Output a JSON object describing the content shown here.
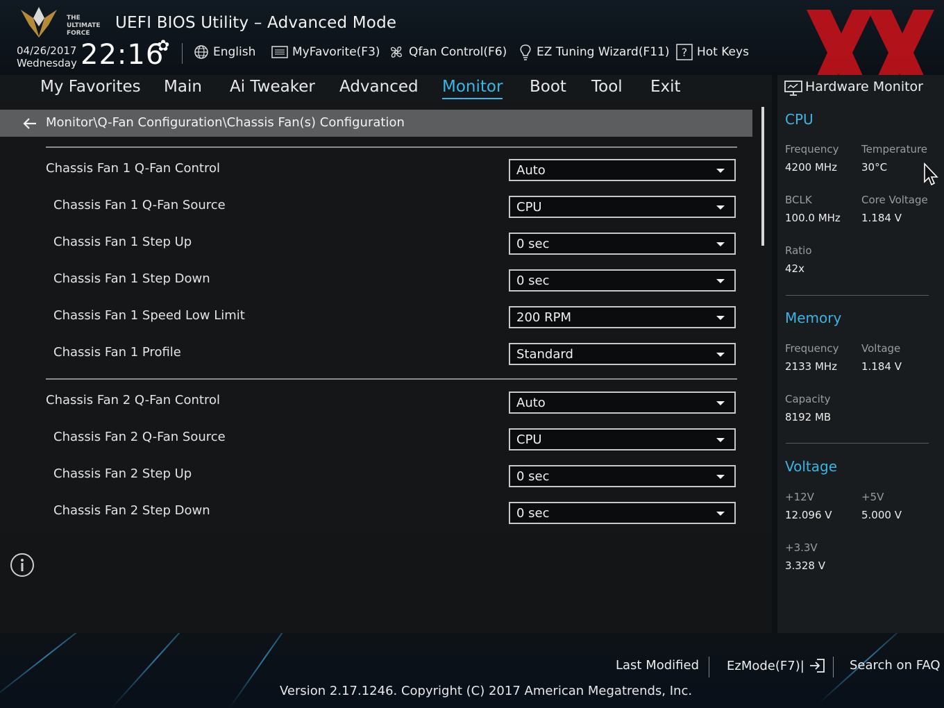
{
  "header": {
    "title": "UEFI BIOS Utility – Advanced Mode",
    "date": "04/26/2017",
    "weekday": "Wednesday",
    "time": "22:16",
    "logo_text": "THE ULTIMATE FORCE",
    "toolbar": [
      {
        "label": "English",
        "icon": "globe-icon"
      },
      {
        "label": "MyFavorite(F3)",
        "icon": "favorite-list-icon"
      },
      {
        "label": "Qfan Control(F6)",
        "icon": "fan-icon"
      },
      {
        "label": "EZ Tuning Wizard(F11)",
        "icon": "lightbulb-icon"
      },
      {
        "label": "Hot Keys",
        "icon": "question-box-icon"
      }
    ]
  },
  "nav": {
    "tabs": [
      "My Favorites",
      "Main",
      "Ai Tweaker",
      "Advanced",
      "Monitor",
      "Boot",
      "Tool",
      "Exit"
    ],
    "active": "Monitor"
  },
  "breadcrumb": "Monitor\\Q-Fan Configuration\\Chassis Fan(s) Configuration",
  "settings": [
    {
      "label": "Chassis Fan 1 Q-Fan Control",
      "value": "Auto"
    },
    {
      "label": "Chassis Fan 1 Q-Fan Source",
      "value": "CPU"
    },
    {
      "label": "Chassis Fan 1 Step Up",
      "value": "0 sec"
    },
    {
      "label": "Chassis Fan 1 Step Down",
      "value": "0 sec"
    },
    {
      "label": "Chassis Fan 1 Speed Low Limit",
      "value": "200 RPM"
    },
    {
      "label": "Chassis Fan 1 Profile",
      "value": "Standard"
    },
    {
      "label": "Chassis Fan 2 Q-Fan Control",
      "value": "Auto"
    },
    {
      "label": "Chassis Fan 2 Q-Fan Source",
      "value": "CPU"
    },
    {
      "label": "Chassis Fan 2 Step Up",
      "value": "0 sec"
    },
    {
      "label": "Chassis Fan 2 Step Down",
      "value": "0 sec"
    }
  ],
  "hardware_monitor": {
    "title": "Hardware Monitor",
    "cpu": {
      "heading": "CPU",
      "frequency_label": "Frequency",
      "frequency": "4200 MHz",
      "temperature_label": "Temperature",
      "temperature": "30°C",
      "bclk_label": "BCLK",
      "bclk": "100.0 MHz",
      "core_voltage_label": "Core Voltage",
      "core_voltage": "1.184 V",
      "ratio_label": "Ratio",
      "ratio": "42x"
    },
    "memory": {
      "heading": "Memory",
      "frequency_label": "Frequency",
      "frequency": "2133 MHz",
      "voltage_label": "Voltage",
      "voltage": "1.184 V",
      "capacity_label": "Capacity",
      "capacity": "8192 MB"
    },
    "voltage": {
      "heading": "Voltage",
      "v12_label": "+12V",
      "v12": "12.096 V",
      "v5_label": "+5V",
      "v5": "5.000 V",
      "v33_label": "+3.3V",
      "v33": "3.328 V"
    }
  },
  "footer": {
    "last_modified": "Last Modified",
    "ezmode": "EzMode(F7)|",
    "search_faq": "Search on FAQ",
    "version": "Version 2.17.1246. Copyright (C) 2017 American Megatrends, Inc."
  },
  "colors": {
    "accent": "#39b7e8",
    "watermark": "#c0121a"
  }
}
